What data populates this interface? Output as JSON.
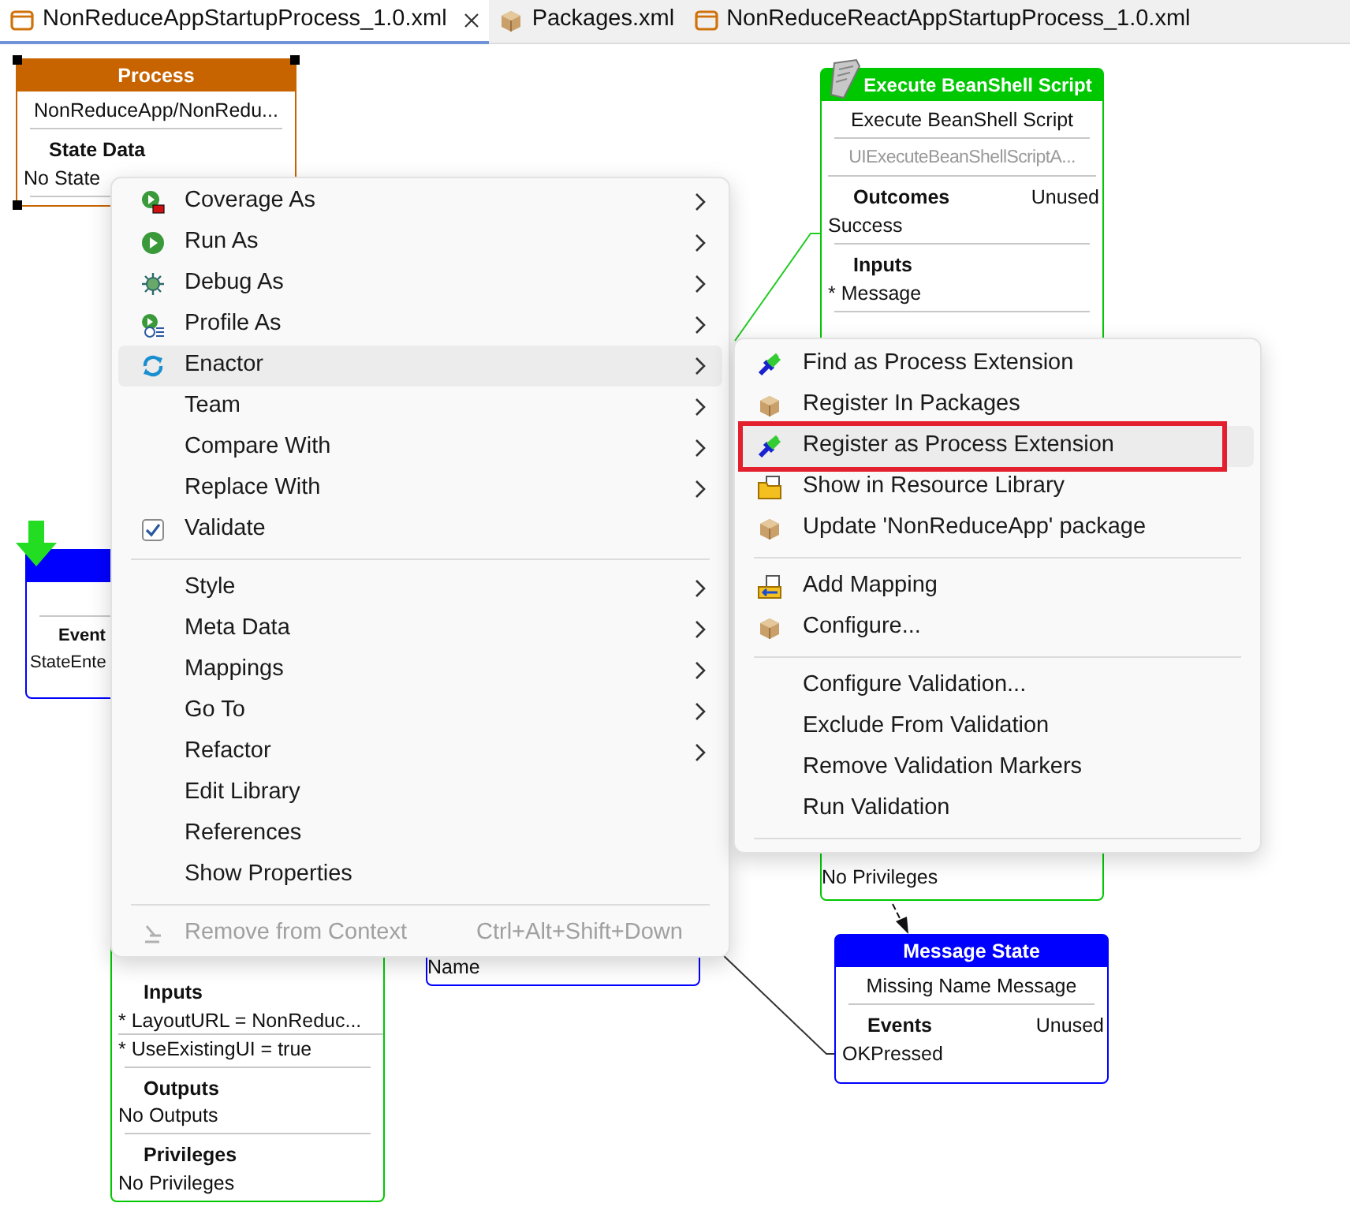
{
  "tabs": [
    {
      "label": "NonReduceAppStartupProcess_1.0.xml",
      "selected": true,
      "closable": true
    },
    {
      "label": "Packages.xml",
      "selected": false,
      "closable": false
    },
    {
      "label": "NonReduceReactAppStartupProcess_1.0.xml",
      "selected": false,
      "closable": false
    }
  ],
  "diagram": {
    "nodes": [
      {
        "title": "Process",
        "color": "#c86400",
        "selected": true,
        "start": false,
        "body": [
          {
            "kind": "line",
            "text": "NonReduceApp/NonRedu...",
            "muted": false
          },
          {
            "kind": "section",
            "heading": "State Data",
            "items": [
              "No State"
            ]
          }
        ]
      },
      {
        "title": "Execute BeanShell Script",
        "color": "#00c800",
        "selected": false,
        "start": false,
        "body": [
          {
            "kind": "line",
            "text": "Execute BeanShell Script",
            "muted": false
          },
          {
            "kind": "line",
            "text": "UIExecuteBeanShellScriptA...",
            "muted": true
          },
          {
            "kind": "section",
            "heading": "Outcomes",
            "status": "Unused",
            "items": [
              "Success"
            ]
          },
          {
            "kind": "section",
            "heading": "Inputs",
            "items": [
              "* Message"
            ]
          },
          {
            "kind": "tail",
            "items": [
              "No Privileges"
            ]
          }
        ]
      },
      {
        "color": "#0000ff",
        "selected": false,
        "start": true,
        "body": [
          {
            "kind": "gap"
          },
          {
            "kind": "section",
            "heading": "Event",
            "items": [
              "StateEnte"
            ]
          }
        ]
      },
      {
        "color": "#00c800",
        "selected": false,
        "start": false,
        "body": [
          {
            "kind": "section",
            "heading": "Inputs",
            "divided": true,
            "items": [
              "* LayoutURL = NonReduc...",
              "* UseExistingUI = true"
            ]
          },
          {
            "kind": "section",
            "heading": "Outputs",
            "items": [
              "No Outputs"
            ]
          },
          {
            "kind": "section",
            "heading": "Privileges",
            "items": [
              "No Privileges"
            ]
          }
        ]
      },
      {
        "color": "#0000ff",
        "selected": false,
        "start": false,
        "body": [
          {
            "kind": "tail",
            "items": [
              "Name"
            ]
          }
        ]
      },
      {
        "title": "Message State",
        "color": "#0000ff",
        "selected": false,
        "start": false,
        "body": [
          {
            "kind": "line",
            "text": "Missing Name Message",
            "muted": false
          },
          {
            "kind": "section",
            "heading": "Events",
            "status": "Unused",
            "items": [
              "OKPressed"
            ]
          }
        ]
      }
    ]
  },
  "context_menu": {
    "items": [
      {
        "kind": "item",
        "label": "Coverage As",
        "submenu": true,
        "hovered": false,
        "disabled": false
      },
      {
        "kind": "item",
        "label": "Run As",
        "submenu": true,
        "hovered": false,
        "disabled": false
      },
      {
        "kind": "item",
        "label": "Debug As",
        "submenu": true,
        "hovered": false,
        "disabled": false
      },
      {
        "kind": "item",
        "label": "Profile As",
        "submenu": true,
        "hovered": false,
        "disabled": false
      },
      {
        "kind": "item",
        "label": "Enactor",
        "submenu": true,
        "hovered": true,
        "disabled": false
      },
      {
        "kind": "item",
        "label": "Team",
        "submenu": true,
        "hovered": false,
        "disabled": false
      },
      {
        "kind": "item",
        "label": "Compare With",
        "submenu": true,
        "hovered": false,
        "disabled": false
      },
      {
        "kind": "item",
        "label": "Replace With",
        "submenu": true,
        "hovered": false,
        "disabled": false
      },
      {
        "kind": "check",
        "label": "Validate",
        "checked": true,
        "submenu": false,
        "hovered": false,
        "disabled": false
      },
      {
        "kind": "separator"
      },
      {
        "kind": "item",
        "label": "Style",
        "submenu": true,
        "hovered": false,
        "disabled": false
      },
      {
        "kind": "item",
        "label": "Meta Data",
        "submenu": true,
        "hovered": false,
        "disabled": false
      },
      {
        "kind": "item",
        "label": "Mappings",
        "submenu": true,
        "hovered": false,
        "disabled": false
      },
      {
        "kind": "item",
        "label": "Go To",
        "submenu": true,
        "hovered": false,
        "disabled": false
      },
      {
        "kind": "item",
        "label": "Refactor",
        "submenu": true,
        "hovered": false,
        "disabled": false
      },
      {
        "kind": "item",
        "label": "Edit Library",
        "submenu": false,
        "hovered": false,
        "disabled": false
      },
      {
        "kind": "item",
        "label": "References",
        "submenu": false,
        "hovered": false,
        "disabled": false
      },
      {
        "kind": "item",
        "label": "Show Properties",
        "submenu": false,
        "hovered": false,
        "disabled": false
      },
      {
        "kind": "separator"
      },
      {
        "kind": "item",
        "label": "Remove from Context",
        "shortcut": "Ctrl+Alt+Shift+Down",
        "submenu": false,
        "hovered": false,
        "disabled": true
      }
    ]
  },
  "submenu": {
    "items": [
      {
        "kind": "item",
        "label": "Find as Process Extension",
        "hovered": false,
        "outlined": false
      },
      {
        "kind": "item",
        "label": "Register In Packages",
        "hovered": false,
        "outlined": false
      },
      {
        "kind": "item",
        "label": "Register as Process Extension",
        "hovered": true,
        "outlined": true
      },
      {
        "kind": "item",
        "label": "Show in Resource Library",
        "hovered": false,
        "outlined": false
      },
      {
        "kind": "item",
        "label": "Update 'NonReduceApp' package",
        "hovered": false,
        "outlined": false
      },
      {
        "kind": "separator"
      },
      {
        "kind": "item",
        "label": "Add Mapping",
        "hovered": false,
        "outlined": false
      },
      {
        "kind": "item",
        "label": "Configure...",
        "hovered": false,
        "outlined": false
      },
      {
        "kind": "separator"
      },
      {
        "kind": "item",
        "label": "Configure Validation...",
        "hovered": false,
        "outlined": false
      },
      {
        "kind": "item",
        "label": "Exclude From Validation",
        "hovered": false,
        "outlined": false
      },
      {
        "kind": "item",
        "label": "Remove Validation Markers",
        "hovered": false,
        "outlined": false
      },
      {
        "kind": "item",
        "label": "Run Validation",
        "hovered": false,
        "outlined": false
      },
      {
        "kind": "separator"
      }
    ]
  }
}
